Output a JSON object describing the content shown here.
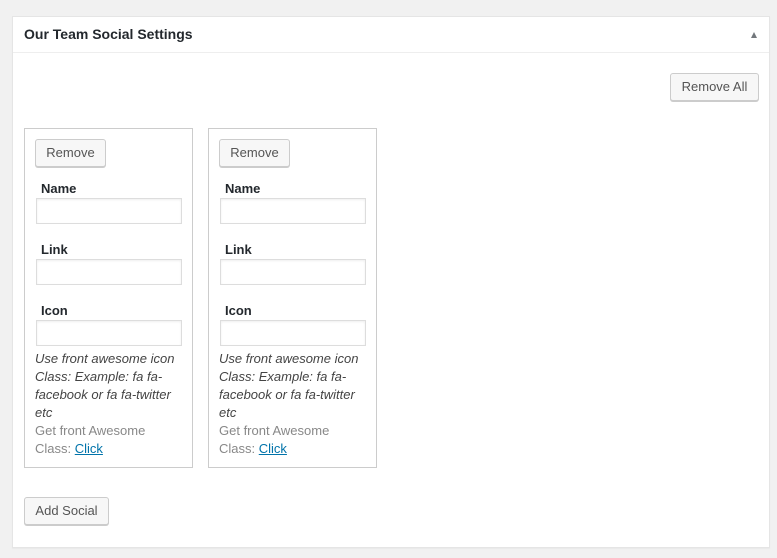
{
  "panel": {
    "title": "Our Team Social Settings",
    "remove_all_label": "Remove All",
    "add_social_label": "Add Social"
  },
  "social_items": [
    {
      "remove_label": "Remove",
      "name_label": "Name",
      "name_value": "",
      "link_label": "Link",
      "link_value": "",
      "icon_label": "Icon",
      "icon_value": "",
      "help_text": "Use front awesome icon Class: Example: fa fa-facebook or fa fa-twitter etc",
      "get_text": "Get front Awesome Class:",
      "get_link": "Click"
    },
    {
      "remove_label": "Remove",
      "name_label": "Name",
      "name_value": "",
      "link_label": "Link",
      "link_value": "",
      "icon_label": "Icon",
      "icon_value": "",
      "help_text": "Use front awesome icon Class: Example: fa fa-facebook or fa fa-twitter etc",
      "get_text": "Get front Awesome Class:",
      "get_link": "Click"
    }
  ],
  "colors": {
    "link": "#0073aa",
    "muted_text": "#888888",
    "border": "#cccccc"
  }
}
